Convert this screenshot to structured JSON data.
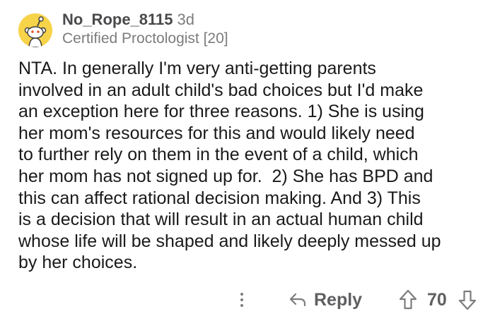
{
  "comment": {
    "author": {
      "username": "No_Rope_8115",
      "age": "3d",
      "flair": "Certified Proctologist [20]",
      "avatar_color": "#f7d34a"
    },
    "body_lines": [
      "NTA. In generally I'm very anti-getting parents",
      "involved in an adult child's bad choices but I'd make",
      "an exception here for three reasons. 1) She is using",
      "her mom's resources for this and would likely need",
      "to further rely on them in the event of a child, which",
      "her mom has not signed up for.  2) She has BPD and",
      "this can affect rational decision making. And 3) This",
      "is a decision that will result in an actual human child",
      "whose life will be shaped and likely deeply messed up",
      "by her choices."
    ],
    "actions": {
      "more_icon": "more-vertical-icon",
      "reply_icon": "reply-arrow-icon",
      "reply_label": "Reply",
      "upvote_icon": "upvote-arrow-icon",
      "score": "70",
      "downvote_icon": "downvote-arrow-icon",
      "icon_color": "#7c7c7c"
    }
  }
}
